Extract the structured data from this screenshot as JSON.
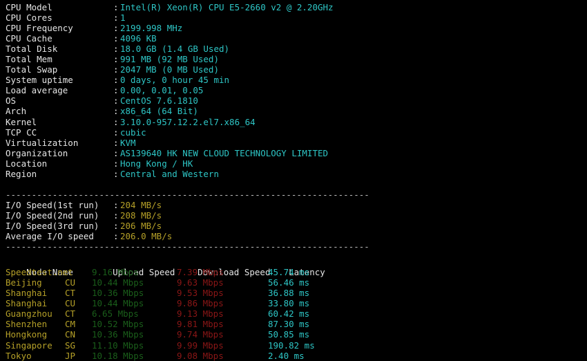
{
  "theme": {
    "background": "#000000",
    "label_color": "#e6e6e6",
    "value_cyan": "#2ec6c6",
    "value_yellow": "#b5a028",
    "upload_color": "#1a5e1a",
    "download_color": "#8a1616",
    "latency_color": "#2ec6c6",
    "divider_color": "#bdbdbd"
  },
  "system_info": {
    "rows": [
      {
        "label": "CPU Model",
        "value": "Intel(R) Xeon(R) CPU E5-2660 v2 @ 2.20GHz"
      },
      {
        "label": "CPU Cores",
        "value": "1"
      },
      {
        "label": "CPU Frequency",
        "value": "2199.998 MHz"
      },
      {
        "label": "CPU Cache",
        "value": "4096 KB"
      },
      {
        "label": "Total Disk",
        "value": "18.0 GB (1.4 GB Used)"
      },
      {
        "label": "Total Mem",
        "value": "991 MB (92 MB Used)"
      },
      {
        "label": "Total Swap",
        "value": "2047 MB (0 MB Used)"
      },
      {
        "label": "System uptime",
        "value": "0 days, 0 hour 45 min"
      },
      {
        "label": "Load average",
        "value": "0.00, 0.01, 0.05"
      },
      {
        "label": "OS",
        "value": "CentOS 7.6.1810"
      },
      {
        "label": "Arch",
        "value": "x86_64 (64 Bit)"
      },
      {
        "label": "Kernel",
        "value": "3.10.0-957.12.2.el7.x86_64"
      },
      {
        "label": "TCP CC",
        "value": "cubic"
      },
      {
        "label": "Virtualization",
        "value": "KVM"
      },
      {
        "label": "Organization",
        "value": "AS139640 HK NEW CLOUD TECHNOLOGY LIMITED"
      },
      {
        "label": "Location",
        "value": "Hong Kong / HK"
      },
      {
        "label": "Region",
        "value": "Central and Western"
      }
    ]
  },
  "divider": "----------------------------------------------------------------------",
  "io_test": {
    "rows": [
      {
        "label": "I/O Speed(1st run)",
        "value": "204 MB/s"
      },
      {
        "label": "I/O Speed(2nd run)",
        "value": "208 MB/s"
      },
      {
        "label": "I/O Speed(3rd run)",
        "value": "206 MB/s"
      },
      {
        "label": "Average I/O speed",
        "value": "206.0 MB/s"
      }
    ]
  },
  "speedtest": {
    "headers": {
      "node": "Node Name",
      "isp": "",
      "upload": "Upload Speed",
      "download": "Download Speed",
      "latency": "Latency"
    },
    "rows": [
      {
        "node": "Speedtest.net",
        "isp": "",
        "upload": "9.16 Mbps",
        "download": "7.39 Mbps",
        "latency": "45.74 ms"
      },
      {
        "node": "Beijing",
        "isp": "CU",
        "upload": "10.44 Mbps",
        "download": "9.63 Mbps",
        "latency": "56.46 ms"
      },
      {
        "node": "Shanghai",
        "isp": "CT",
        "upload": "10.36 Mbps",
        "download": "9.53 Mbps",
        "latency": "36.88 ms"
      },
      {
        "node": "Shanghai",
        "isp": "CU",
        "upload": "10.44 Mbps",
        "download": "9.86 Mbps",
        "latency": "33.80 ms"
      },
      {
        "node": "Guangzhou",
        "isp": "CT",
        "upload": "6.65 Mbps",
        "download": "9.13 Mbps",
        "latency": "60.42 ms"
      },
      {
        "node": "Shenzhen",
        "isp": "CM",
        "upload": "10.52 Mbps",
        "download": "9.81 Mbps",
        "latency": "87.30 ms"
      },
      {
        "node": "Hongkong",
        "isp": "CN",
        "upload": "10.36 Mbps",
        "download": "9.74 Mbps",
        "latency": "50.85 ms"
      },
      {
        "node": "Singapore",
        "isp": "SG",
        "upload": "11.10 Mbps",
        "download": "9.99 Mbps",
        "latency": "190.82 ms"
      },
      {
        "node": "Tokyo",
        "isp": "JP",
        "upload": "10.18 Mbps",
        "download": "9.08 Mbps",
        "latency": "2.40 ms"
      }
    ]
  }
}
